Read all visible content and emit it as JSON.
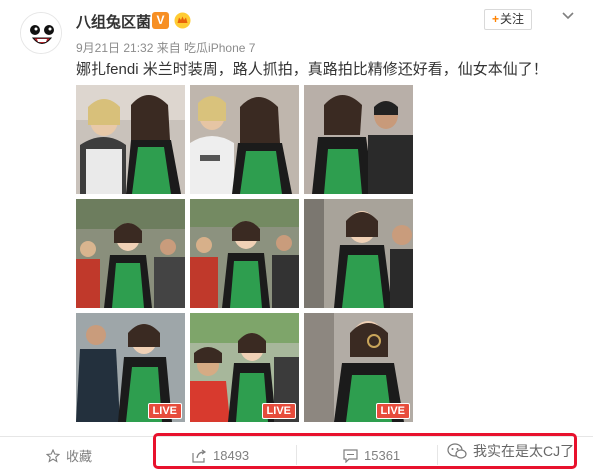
{
  "post": {
    "username": "八组兔区菌",
    "verified_badge": "V",
    "meta": "9月21日 21:32 来自 吃瓜iPhone 7",
    "follow_label": "关注",
    "content": "娜扎fendi 米兰时装周，路人抓拍，真路拍比精修还好看，仙女本仙了！"
  },
  "photos": [
    {
      "live": false
    },
    {
      "live": false
    },
    {
      "live": false
    },
    {
      "live": false
    },
    {
      "live": false
    },
    {
      "live": false
    },
    {
      "live": true,
      "live_label": "LIVE"
    },
    {
      "live": true,
      "live_label": "LIVE"
    },
    {
      "live": true,
      "live_label": "LIVE"
    }
  ],
  "actions": {
    "favorite_label": "收藏",
    "repost_count": "18493",
    "comment_count": "15361"
  },
  "watermark": "我实在是太CJ了",
  "colors": {
    "accent_orange": "#ff8200",
    "highlight_red": "#e8112d",
    "dress_green": "#2e9e4f"
  }
}
